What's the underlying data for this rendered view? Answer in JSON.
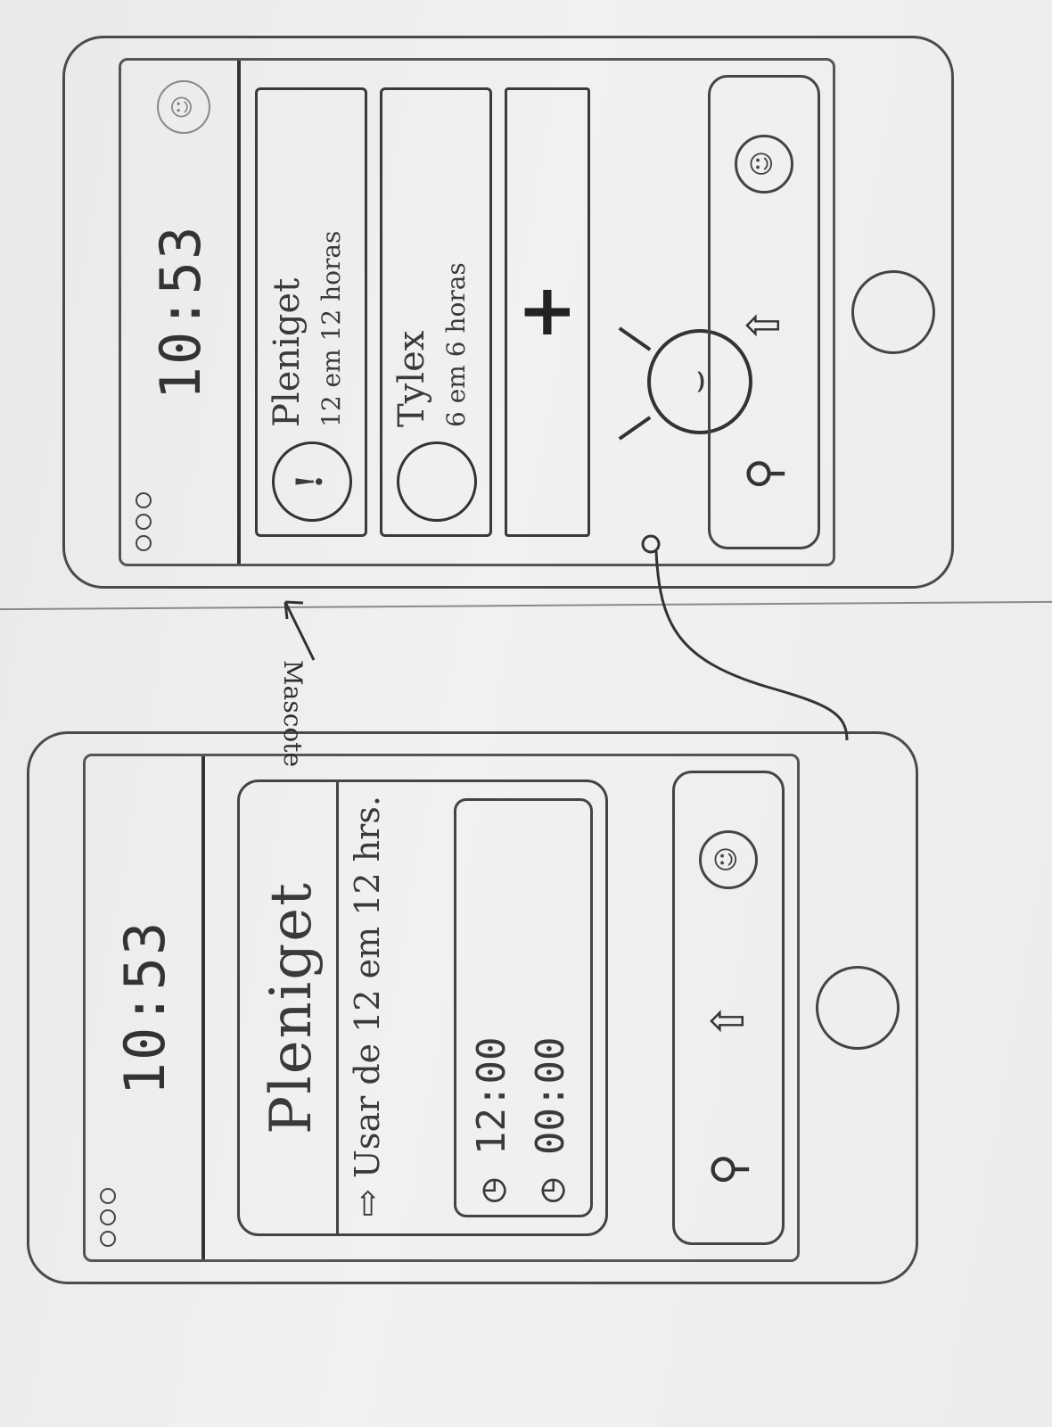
{
  "sketch": {
    "annotation_label": "Mascote",
    "screen_home": {
      "clock": "10:53",
      "medications": [
        {
          "name": "Pleniget",
          "dose": "12 em 12 horas",
          "icon": "clock-icon"
        },
        {
          "name": "Tylex",
          "dose": "6 em 6 horas",
          "icon": "empty-circle-icon"
        }
      ],
      "add_label": "+",
      "mascot_face": "⌣",
      "navbar": {
        "left_icon": "search-icon",
        "center_icon": "arrow-icon",
        "right_icon": "profile-icon"
      }
    },
    "screen_detail": {
      "clock": "10:53",
      "title": "Pleniget",
      "instruction": "⇨ Usar de 12 em 12 hrs.",
      "times": [
        "12:00",
        "00:00"
      ],
      "navbar": {
        "left_icon": "search-icon",
        "center_icon": "arrow-icon",
        "right_icon": "profile-icon"
      }
    }
  }
}
